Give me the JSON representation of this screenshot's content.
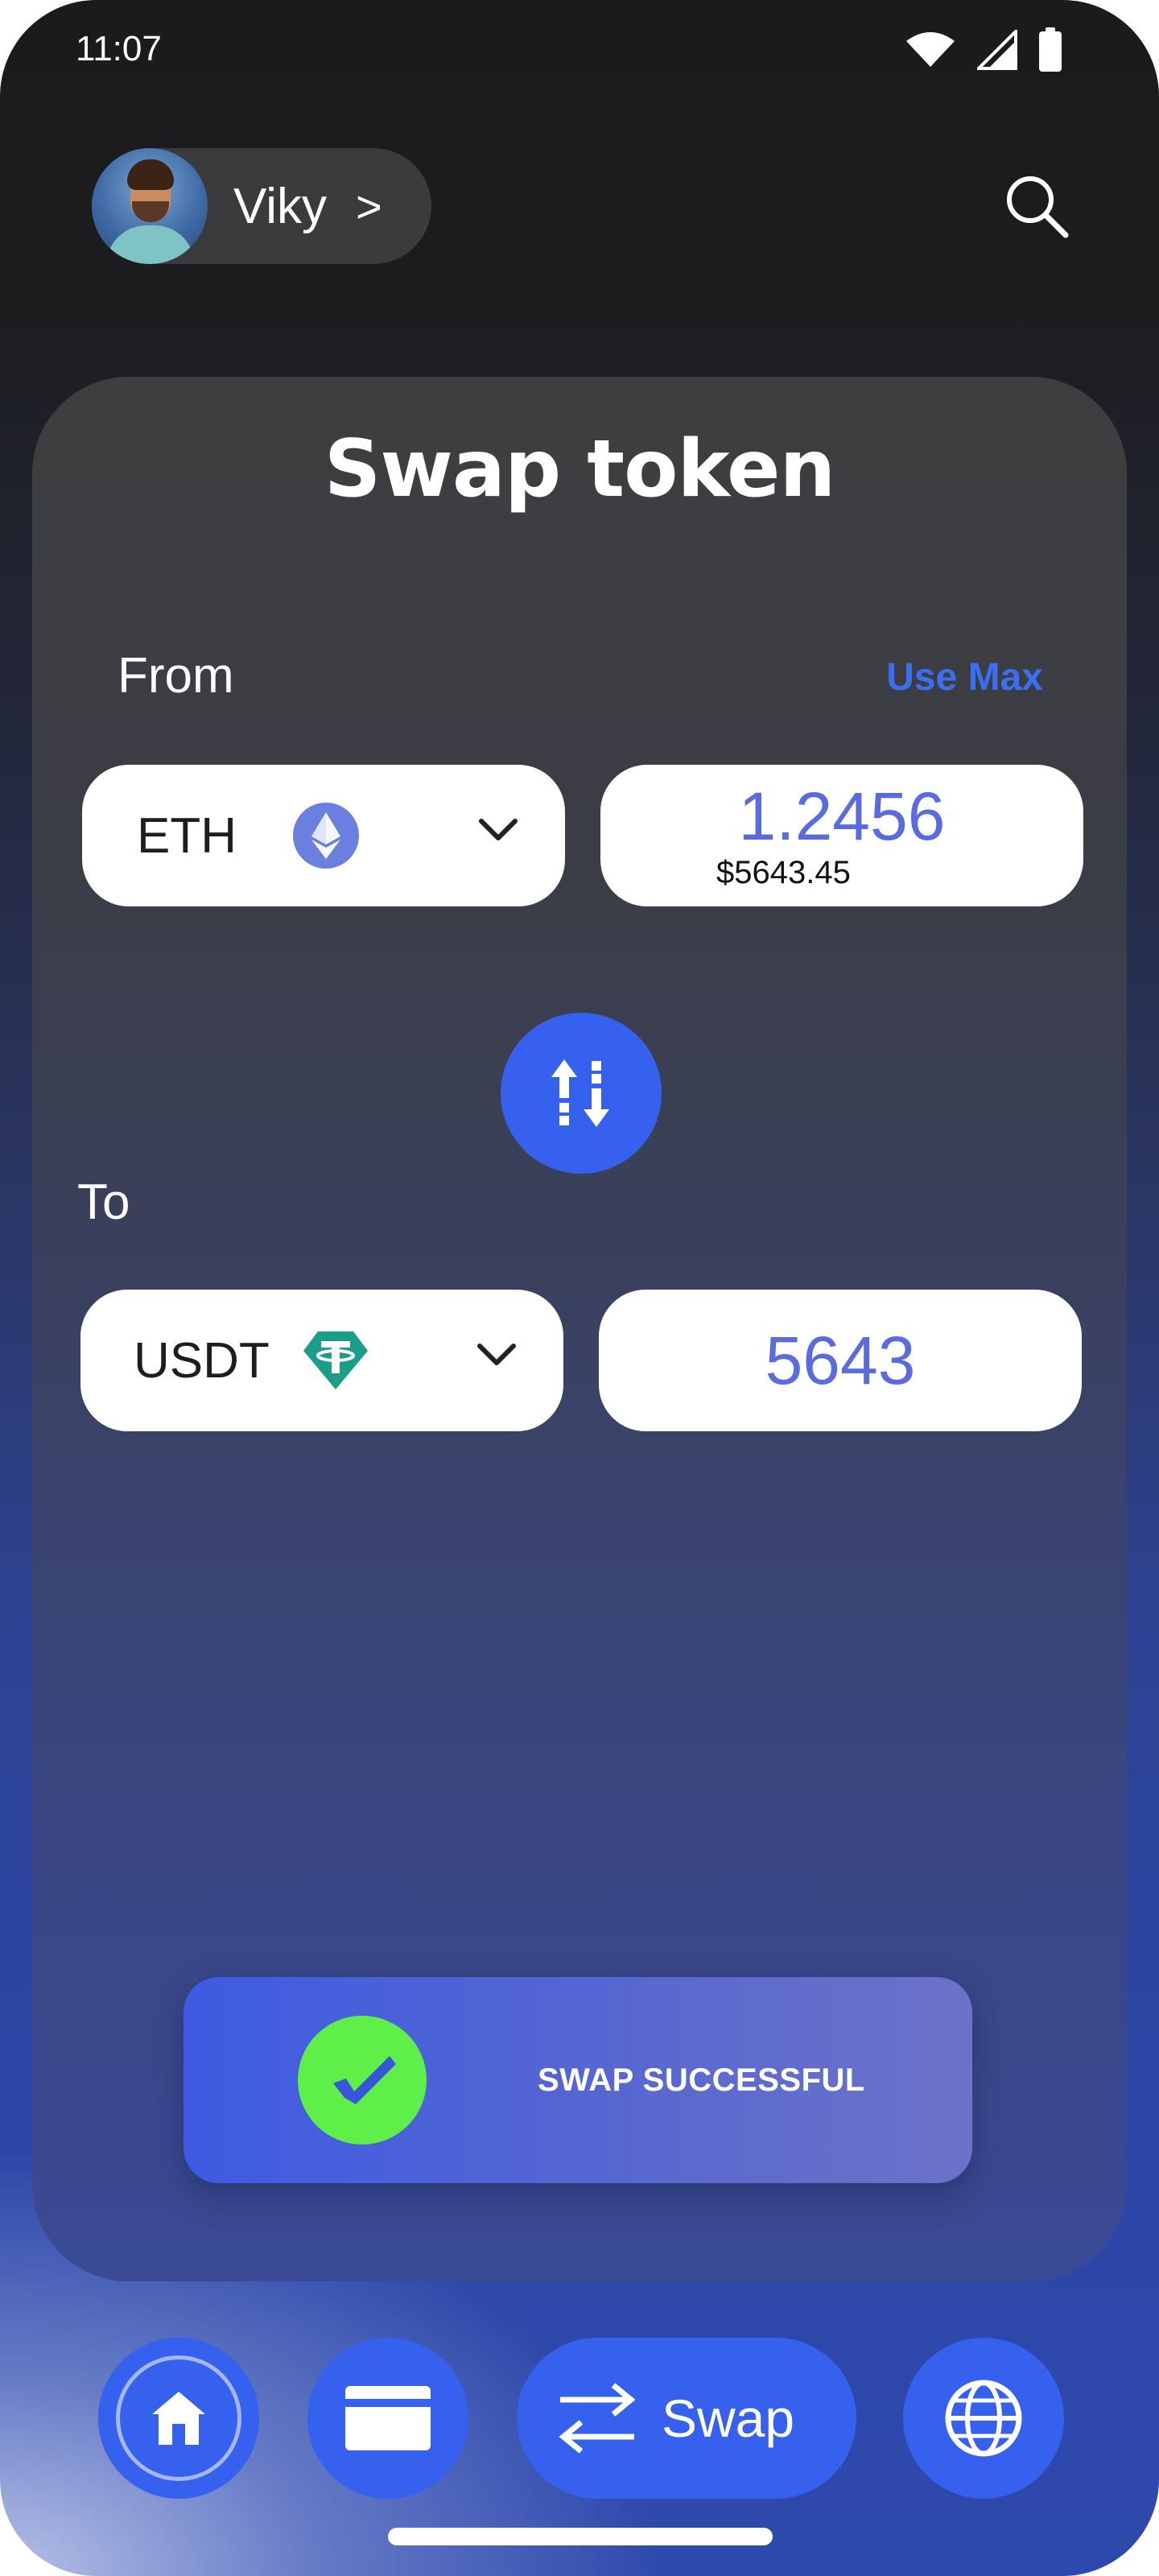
{
  "status_bar": {
    "time": "11:07"
  },
  "profile": {
    "name": "Viky",
    "chevron": ">"
  },
  "title": "Swap token",
  "from": {
    "label": "From",
    "use_max": "Use Max",
    "token": "ETH",
    "token_icon": "ethereum-icon",
    "amount": "1.2456",
    "usd_value": "$5643.45"
  },
  "to": {
    "label": "To",
    "token": "USDT",
    "token_icon": "tether-icon",
    "amount": "5643"
  },
  "toast": {
    "message": "SWAP SUCCESSFUL"
  },
  "nav": {
    "items": [
      {
        "icon": "home-icon"
      },
      {
        "icon": "wallet-icon"
      },
      {
        "icon": "swap-arrows-icon",
        "label": "Swap"
      },
      {
        "icon": "globe-icon"
      }
    ]
  },
  "colors": {
    "accent": "#3561ee",
    "use_max": "#3b6ef0",
    "amount_text": "#5a6be0",
    "success": "#5ef048",
    "tether": "#1a9e8a",
    "ethereum": "#6a7fe0"
  }
}
